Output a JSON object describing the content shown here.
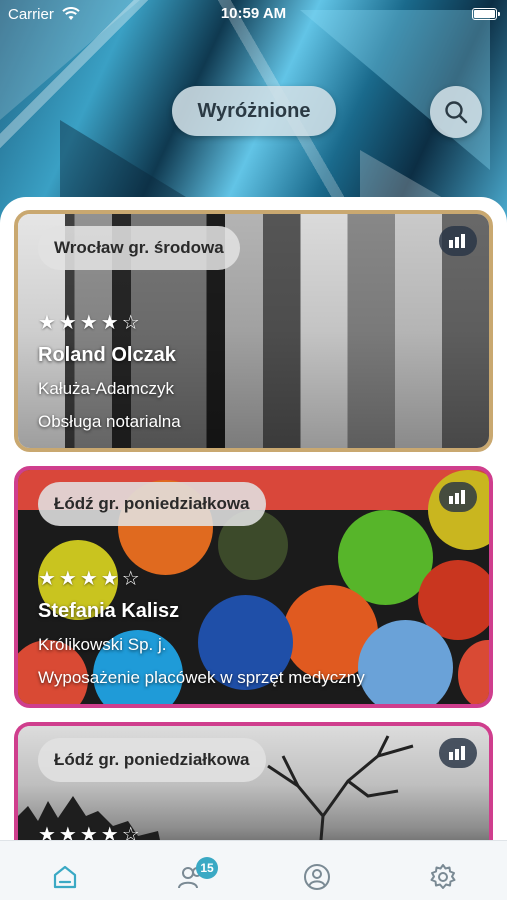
{
  "status_bar": {
    "carrier": "Carrier",
    "time": "10:59 AM"
  },
  "header": {
    "title": "Wyróżnione",
    "search_icon": "search-icon"
  },
  "cards": [
    {
      "location": "Wrocław gr. środowa",
      "rating": "★★★★☆",
      "name": "Roland Olczak",
      "company": "Kałuża-Adamczyk",
      "service": "Obsługa notarialna",
      "border_color": "#c9a870",
      "stats_icon": "bar-chart-icon"
    },
    {
      "location": "Łódź gr. poniedziałkowa",
      "rating": "★★★★☆",
      "name": "Stefania Kalisz",
      "company": "Królikowski Sp. j.",
      "service": "Wyposażenie placówek w sprzęt medyczny",
      "border_color": "#cf3e8d",
      "stats_icon": "bar-chart-icon"
    },
    {
      "location": "Łódź gr. poniedziałkowa",
      "rating": "★★★★☆",
      "border_color": "#cf3e8d",
      "stats_icon": "bar-chart-icon"
    }
  ],
  "tabbar": {
    "items": [
      {
        "icon": "home-icon",
        "active": true
      },
      {
        "icon": "people-icon",
        "badge": "15"
      },
      {
        "icon": "profile-icon"
      },
      {
        "icon": "gear-icon"
      }
    ],
    "active_color": "#3aa9c4",
    "inactive_color": "#7a8a94"
  }
}
